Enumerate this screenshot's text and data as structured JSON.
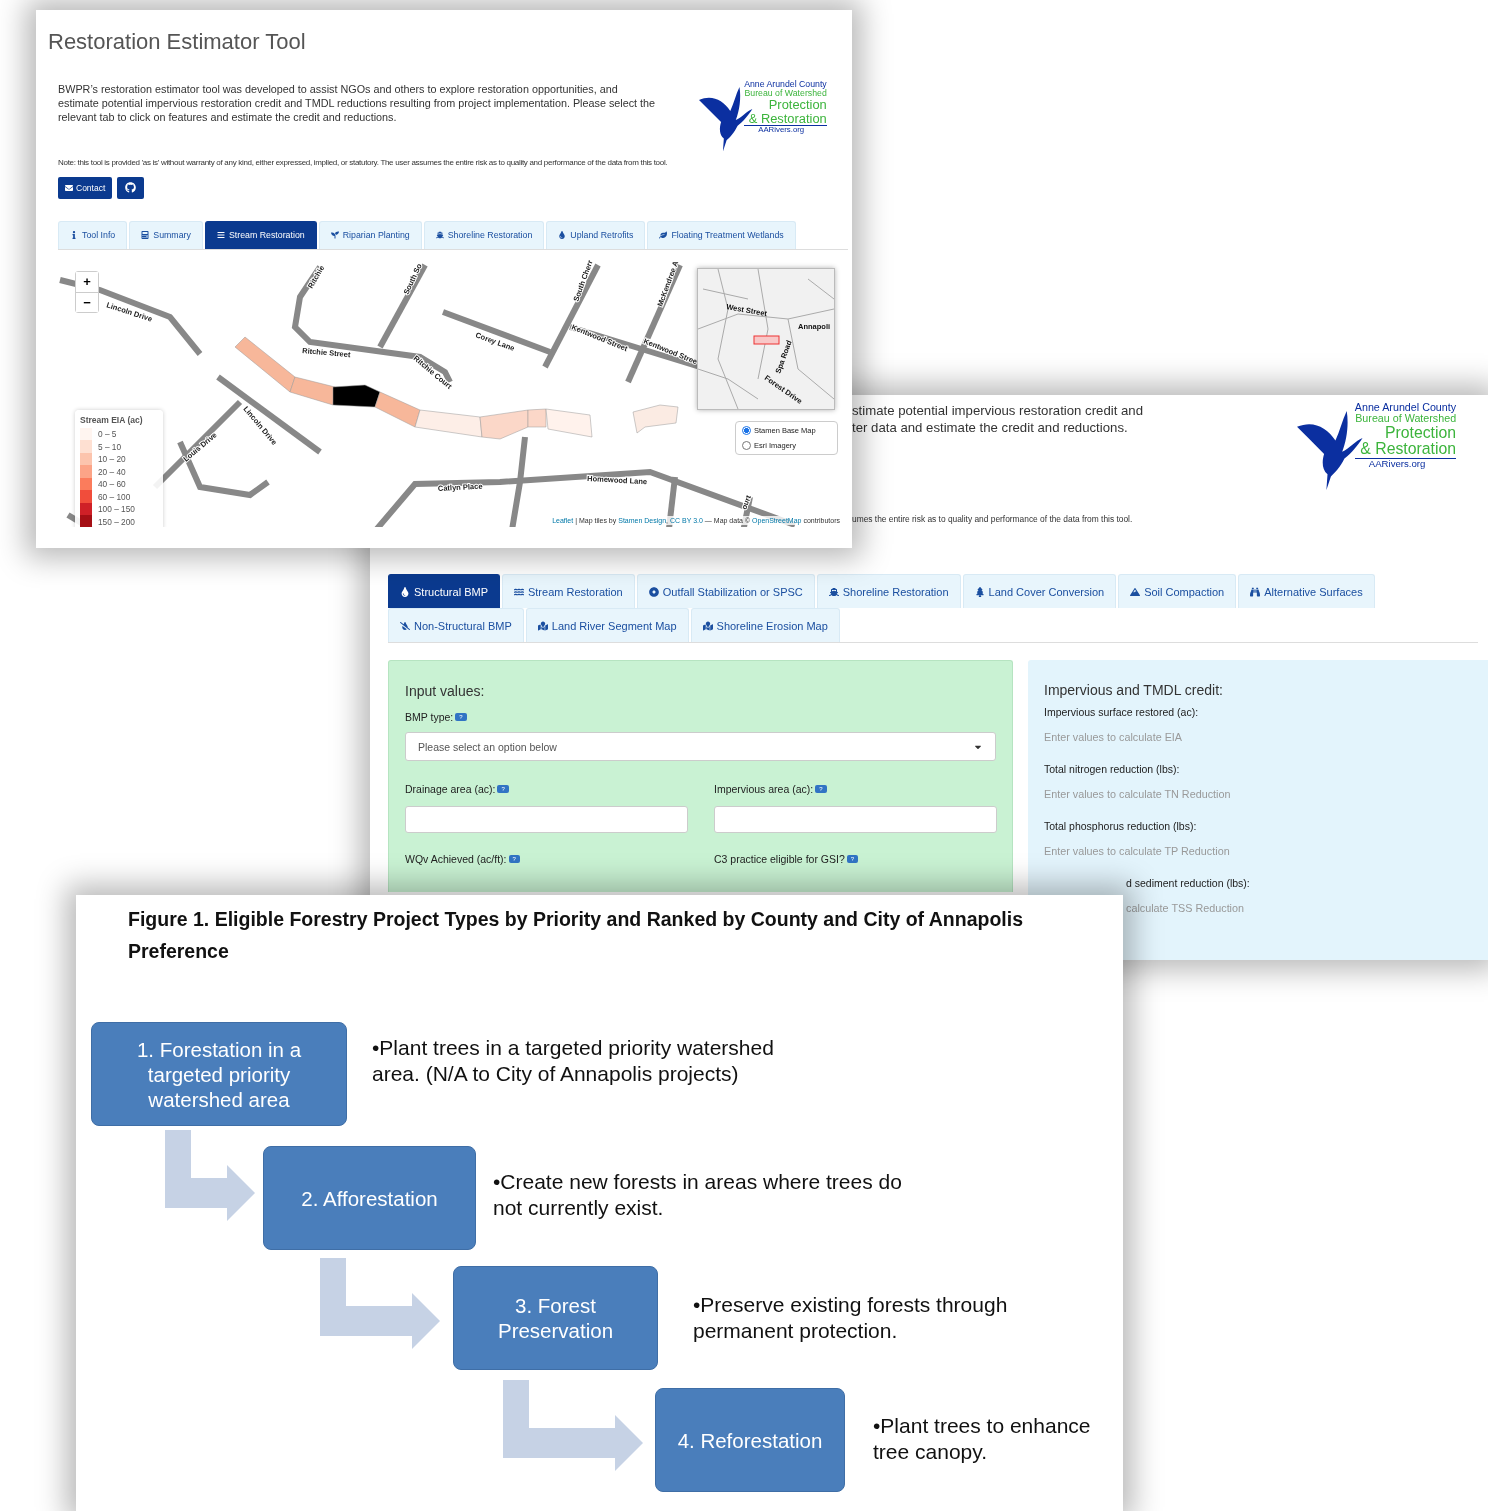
{
  "estimator": {
    "title": "Restoration Estimator Tool",
    "intro": "BWPR’s restoration estimator tool was developed to assist NGOs and others to explore restoration opportunities, and estimate potential impervious restoration credit and TMDL reductions resulting from project implementation. Please select the relevant tab to click on features and estimate the credit and reductions.",
    "logo": [
      "Anne Arundel County",
      "Bureau of Watershed",
      "Protection",
      "& Restoration",
      "AARivers.org"
    ],
    "note": "Note: this tool is provided 'as is' without warranty of any kind, either expressed, implied, or statutory. The user assumes the entire risk as to quality and performance of the data from this tool.",
    "contact_button": "Contact",
    "tabs": [
      {
        "label": "Tool Info",
        "selected": false
      },
      {
        "label": "Summary",
        "selected": false
      },
      {
        "label": "Stream Restoration",
        "selected": true
      },
      {
        "label": "Riparian Planting",
        "selected": false
      },
      {
        "label": "Shoreline Restoration",
        "selected": false
      },
      {
        "label": "Upland Retrofits",
        "selected": false
      },
      {
        "label": "Floating Treatment Wetlands",
        "selected": false
      }
    ],
    "map": {
      "zoom": [
        "+",
        "−"
      ],
      "streets": [
        "Lincoln Drive",
        "Ritchie",
        "South So",
        "Ritchie Street",
        "Ritchie Court",
        "Corey Lane",
        "South Cherr",
        "Kentwood Street",
        "McKendree A",
        "Kentwood Stree",
        "Lincoln Drive",
        "Louis Drive",
        "Catlyn Place",
        "Homewood Lane",
        "ourt"
      ],
      "legend": {
        "title": "Stream EIA (ac)",
        "items": [
          {
            "label": "0 – 5",
            "color": "#fff5f0"
          },
          {
            "label": "5 – 10",
            "color": "#fee0d2"
          },
          {
            "label": "10 – 20",
            "color": "#fcc4ad"
          },
          {
            "label": "20 – 40",
            "color": "#fca487"
          },
          {
            "label": "40 – 60",
            "color": "#fb7c5c"
          },
          {
            "label": "60 – 100",
            "color": "#f14d3b"
          },
          {
            "label": "100 – 150",
            "color": "#cf2027"
          },
          {
            "label": "150 – 200",
            "color": "#a50f15"
          }
        ]
      },
      "inset_labels": [
        "West Street",
        "Annapoli",
        "Spa Road",
        "Forest Drive"
      ],
      "layers": [
        {
          "label": "Stamen Base Map",
          "selected": true
        },
        {
          "label": "Esri Imagery",
          "selected": false
        }
      ],
      "attribution": [
        {
          "kind": "link",
          "text": "Leaflet"
        },
        {
          "kind": "text",
          "text": " | Map tiles by "
        },
        {
          "kind": "link",
          "text": "Stamen Design"
        },
        {
          "kind": "text",
          "text": ", "
        },
        {
          "kind": "link",
          "text": "CC BY 3.0"
        },
        {
          "kind": "text",
          "text": " — Map data © "
        },
        {
          "kind": "link",
          "text": "OpenStreetMap"
        },
        {
          "kind": "text",
          "text": " contributors"
        }
      ]
    }
  },
  "bmp_tool": {
    "intro_lines": [
      "stimate potential impervious restoration credit and",
      "ter data and estimate the credit and reductions."
    ],
    "logo": [
      "Anne Arundel County",
      "Bureau of Watershed",
      "Protection",
      "& Restoration",
      "AARivers.org"
    ],
    "note": "umes the entire risk as to quality and performance of the data from this tool.",
    "tab_rows": [
      [
        {
          "label": "Structural BMP",
          "selected": true
        },
        {
          "label": "Stream Restoration",
          "selected": false
        },
        {
          "label": "Outfall Stabilization or SPSC",
          "selected": false
        },
        {
          "label": "Shoreline Restoration",
          "selected": false
        },
        {
          "label": "Land Cover Conversion",
          "selected": false
        },
        {
          "label": "Soil Compaction",
          "selected": false
        },
        {
          "label": "Alternative Surfaces",
          "selected": false
        }
      ],
      [
        {
          "label": "Non-Structural BMP",
          "selected": false
        },
        {
          "label": "Land River Segment Map",
          "selected": false
        },
        {
          "label": "Shoreline Erosion Map",
          "selected": false
        }
      ]
    ],
    "inputs": {
      "title": "Input values:",
      "bmp_type": {
        "label": "BMP type:",
        "help": "?",
        "placeholder": "Please select an option below"
      },
      "fields": [
        {
          "label": "Drainage area (ac):",
          "help": "?"
        },
        {
          "label": "Impervious area (ac):",
          "help": "?"
        }
      ],
      "more_fields": [
        {
          "label": "WQv Achieved (ac/ft):",
          "help": "?"
        },
        {
          "label": "C3 practice eligible for GSI?",
          "help": "?"
        }
      ]
    },
    "credit": {
      "title": "Impervious and TMDL credit:",
      "items": [
        {
          "label": "Impervious surface restored (ac):",
          "hint": "Enter values to calculate EIA"
        },
        {
          "label": "Total nitrogen reduction (lbs):",
          "hint": "Enter values to calculate TN Reduction"
        },
        {
          "label": "Total phosphorus reduction (lbs):",
          "hint": "Enter values to calculate TP Reduction"
        },
        {
          "label": "d sediment reduction (lbs):",
          "hint": "calculate TSS Reduction"
        }
      ]
    }
  },
  "figure": {
    "title": "Figure 1. Eligible Forestry Project Types by Priority and Ranked by County and City of Annapolis Preference",
    "steps": [
      {
        "box": "1. Forestation in a targeted priority watershed area",
        "text": "•Plant trees in a targeted priority watershed area. (N/A to City of Annapolis projects)"
      },
      {
        "box": "2. Afforestation",
        "text": "•Create new forests in areas where trees do not currently exist."
      },
      {
        "box": "3. Forest Preservation",
        "text": "•Preserve existing forests through permanent protection."
      },
      {
        "box": "4. Reforestation",
        "text": "•Plant trees to enhance tree canopy."
      }
    ]
  }
}
